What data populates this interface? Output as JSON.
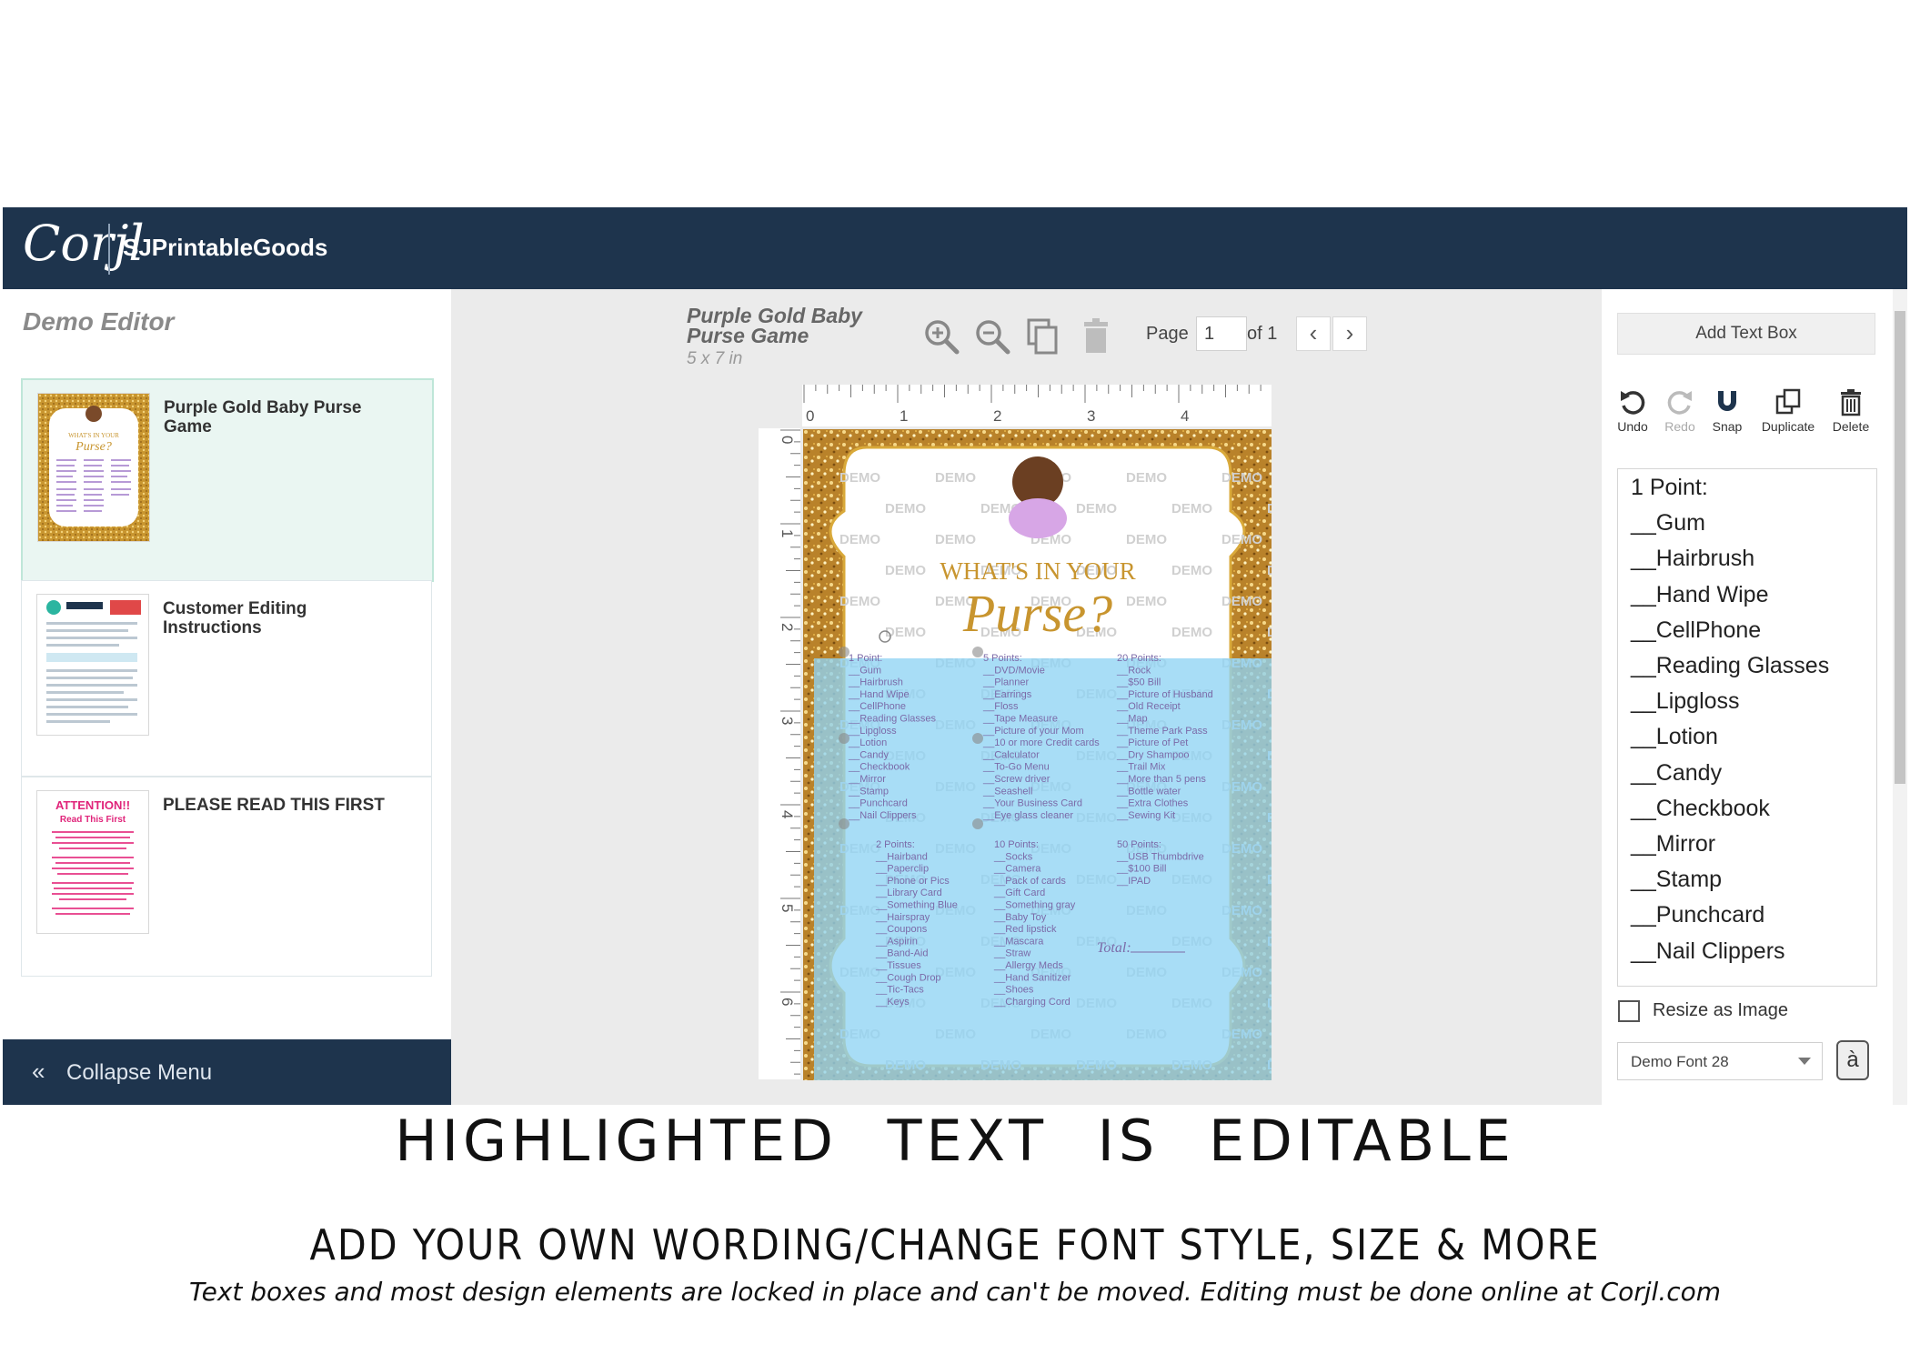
{
  "topbar": {
    "logo": "Corjl",
    "brand": "SJPrintableGoods"
  },
  "sidebar": {
    "title": "Demo Editor",
    "projects": [
      {
        "title": "Purple Gold Baby Purse Game"
      },
      {
        "title": "Customer Editing Instructions"
      },
      {
        "title": "PLEASE READ THIS FIRST"
      }
    ],
    "attention_thumb": {
      "heading": "ATTENTION!!",
      "sub": "Read This First"
    },
    "collapse_label": "Collapse Menu"
  },
  "document": {
    "title": "Purple Gold Baby Purse Game",
    "size": "5 x 7 in"
  },
  "toolbar": {
    "icons": [
      "zoom-in-icon",
      "zoom-out-icon",
      "copy-icon",
      "trash-icon"
    ],
    "page_label": "Page",
    "page_value": "1",
    "page_of": "of 1"
  },
  "rulers": {
    "h_labels": [
      "0",
      "1",
      "2",
      "3",
      "4"
    ],
    "v_labels": [
      "0",
      "1",
      "2",
      "3",
      "4",
      "5",
      "6"
    ]
  },
  "canvas": {
    "watermark": "DEMO",
    "heading": "WHAT'S IN YOUR",
    "script": "Purse?",
    "total_label": "Total:",
    "col1_a": [
      "1 Point:",
      "__Gum",
      "__Hairbrush",
      "__Hand Wipe",
      "__CellPhone",
      "__Reading Glasses",
      "__Lipgloss",
      "__Lotion",
      "__Candy",
      "__Checkbook",
      "__Mirror",
      "__Stamp",
      "__Punchcard",
      "__Nail Clippers"
    ],
    "col2_a": [
      "5 Points:",
      "__DVD/Movie",
      "__Planner",
      "__Earrings",
      "__Floss",
      "__Tape Measure",
      "__Picture of your Mom",
      "__10 or more Credit cards",
      "__Calculator",
      "__To-Go Menu",
      "__Screw driver",
      "__Seashell",
      "__Your Business Card",
      "__Eye glass cleaner"
    ],
    "col3_a": [
      "20 Points:",
      "__Rock",
      "__$50 Bill",
      "__Picture of Husband",
      "__Old Receipt",
      "__Map",
      "__Theme Park Pass",
      "__Picture of Pet",
      "__Dry Shampoo",
      "__Trail Mix",
      "__More than 5 pens",
      "__Bottle water",
      "__Extra Clothes",
      "__Sewing Kit"
    ],
    "col1_b": [
      "2 Points:",
      "__Hairband",
      "__Paperclip",
      "__Phone or Pics",
      "__Library Card",
      "__Something Blue",
      "__Hairspray",
      "__Coupons",
      "__Aspirin",
      "__Band-Aid",
      "__Tissues",
      "__Cough Drop",
      "__Tic-Tacs",
      "__Keys"
    ],
    "col2_b": [
      "10 Points:",
      "__Socks",
      "__Camera",
      "__Pack of cards",
      "__Gift Card",
      "__Something gray",
      "__Baby Toy",
      "__Red lipstick",
      "__Mascara",
      "__Straw",
      "__Allergy Meds",
      "__Hand Sanitizer",
      "__Shoes",
      "__Charging Cord"
    ],
    "col3_b": [
      "50 Points:",
      "__USB Thumbdrive",
      "__$100 Bill",
      "__IPAD"
    ]
  },
  "right_panel": {
    "add_text_box": "Add Text Box",
    "tools": [
      {
        "label": "Undo",
        "icon": "undo-icon"
      },
      {
        "label": "Redo",
        "icon": "redo-icon"
      },
      {
        "label": "Snap",
        "icon": "magnet-icon"
      },
      {
        "label": "Duplicate",
        "icon": "duplicate-icon"
      },
      {
        "label": "Delete",
        "icon": "trash-icon"
      }
    ],
    "text_lines": [
      "1 Point:",
      "__Gum",
      "__Hairbrush",
      "__Hand Wipe",
      "__CellPhone",
      "__Reading Glasses",
      "__Lipgloss",
      "__Lotion",
      "__Candy",
      "__Checkbook",
      "__Mirror",
      "__Stamp",
      "__Punchcard",
      "__Nail Clippers"
    ],
    "resize_label": "Resize as Image",
    "font_value": "Demo Font 28",
    "font_button_glyph": "à"
  },
  "captions": {
    "line1": "HIGHLIGHTED TEXT IS EDITABLE",
    "line2": "ADD YOUR OWN WORDING/CHANGE FONT STYLE, SIZE & MORE",
    "line3": "Text boxes and most design elements are locked in place and can't be moved. Editing must be done online at Corjl.com"
  },
  "colors": {
    "navy": "#1e344d",
    "highlight": "#8fd3f4",
    "gold": "#c8952f",
    "teal": "#2bb5a0"
  }
}
